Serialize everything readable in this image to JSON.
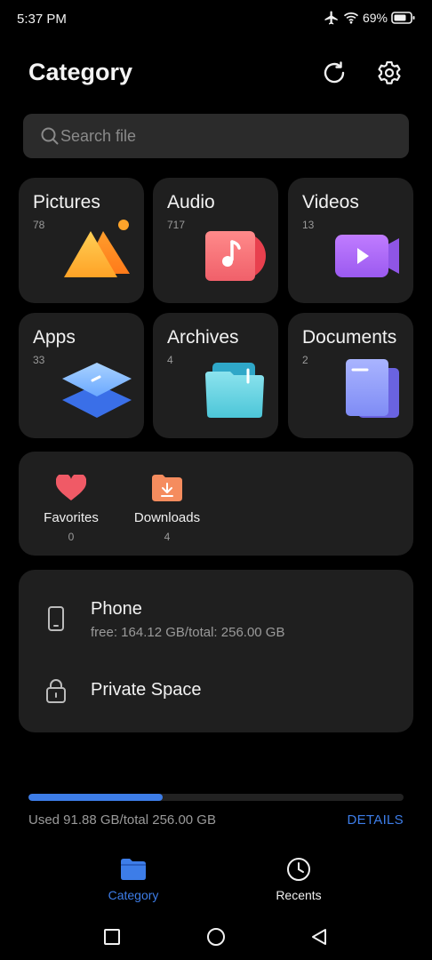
{
  "status_bar": {
    "time": "5:37 PM",
    "battery": "69%"
  },
  "header": {
    "title": "Category",
    "refresh_icon": "refresh-icon",
    "settings_icon": "gear-icon"
  },
  "search": {
    "placeholder": "Search file",
    "value": ""
  },
  "categories": [
    {
      "name": "Pictures",
      "count": "78",
      "icon": "pictures-icon"
    },
    {
      "name": "Audio",
      "count": "717",
      "icon": "audio-icon"
    },
    {
      "name": "Videos",
      "count": "13",
      "icon": "videos-icon"
    },
    {
      "name": "Apps",
      "count": "33",
      "icon": "apps-icon"
    },
    {
      "name": "Archives",
      "count": "4",
      "icon": "archives-icon"
    },
    {
      "name": "Documents",
      "count": "2",
      "icon": "documents-icon"
    }
  ],
  "quick_access": [
    {
      "label": "Favorites",
      "count": "0",
      "icon": "heart-icon"
    },
    {
      "label": "Downloads",
      "count": "4",
      "icon": "download-folder-icon"
    }
  ],
  "storage": {
    "phone": {
      "title": "Phone",
      "subtitle": "free: 164.12 GB/total: 256.00 GB",
      "icon": "phone-icon"
    },
    "private": {
      "title": "Private Space",
      "icon": "lock-icon"
    }
  },
  "usage": {
    "text": "Used 91.88 GB/total 256.00 GB",
    "fraction": 0.359,
    "details_label": "DETAILS"
  },
  "tabs": [
    {
      "label": "Category",
      "icon": "folder-icon",
      "active": true
    },
    {
      "label": "Recents",
      "icon": "clock-icon",
      "active": false
    }
  ],
  "colors": {
    "accent": "#3d7de8",
    "card": "#1f1f1f",
    "background": "#000000"
  }
}
